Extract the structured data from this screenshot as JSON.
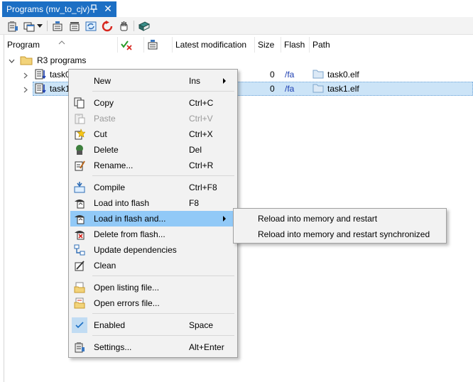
{
  "window": {
    "tab_title": "Programs (mv_to_cjv)",
    "pin_icon": "pin-icon",
    "close_label": "✕"
  },
  "toolbar": {
    "buttons": [
      {
        "icon": "properties-icon"
      },
      {
        "icon": "new-window-icon"
      },
      {
        "icon": "compile-all-icon"
      },
      {
        "icon": "load-all-icon"
      },
      {
        "icon": "refresh-icon"
      },
      {
        "icon": "restart-icon"
      },
      {
        "icon": "stop-hand-icon"
      },
      {
        "icon": "book-icon"
      }
    ]
  },
  "columns": {
    "program": "Program",
    "latest_modification": "Latest modification",
    "size": "Size",
    "flash": "Flash",
    "path": "Path"
  },
  "tree": {
    "root_label": "R3 programs",
    "rows": [
      {
        "name": "task0",
        "size": "0",
        "flash": "/fa",
        "path": "task0.elf"
      },
      {
        "name": "task1",
        "size": "0",
        "flash": "/fa",
        "path": "task1.elf"
      }
    ]
  },
  "context_menu": {
    "new": {
      "label": "New",
      "shortcut": "Ins"
    },
    "copy": {
      "label": "Copy",
      "shortcut": "Ctrl+C"
    },
    "paste": {
      "label": "Paste",
      "shortcut": "Ctrl+V"
    },
    "cut": {
      "label": "Cut",
      "shortcut": "Ctrl+X"
    },
    "delete": {
      "label": "Delete",
      "shortcut": "Del"
    },
    "rename": {
      "label": "Rename...",
      "shortcut": "Ctrl+R"
    },
    "compile": {
      "label": "Compile",
      "shortcut": "Ctrl+F8"
    },
    "load_into_flash": {
      "label": "Load into flash",
      "shortcut": "F8"
    },
    "load_in_flash_and": {
      "label": "Load in flash and..."
    },
    "delete_from_flash": {
      "label": "Delete from flash..."
    },
    "update_dependencies": {
      "label": "Update dependencies"
    },
    "clean": {
      "label": "Clean"
    },
    "open_listing": {
      "label": "Open listing file..."
    },
    "open_errors": {
      "label": "Open errors file..."
    },
    "enabled": {
      "label": "Enabled",
      "shortcut": "Space"
    },
    "settings": {
      "label": "Settings...",
      "shortcut": "Alt+Enter"
    }
  },
  "submenu": {
    "reload_restart": "Reload into memory and restart",
    "reload_restart_sync": "Reload into memory and restart synchronized"
  },
  "colors": {
    "tab_active": "#1c6fc4",
    "selection": "#cce4f7",
    "menu_highlight": "#91c9f7",
    "flash_text": "#1a3cb0"
  }
}
